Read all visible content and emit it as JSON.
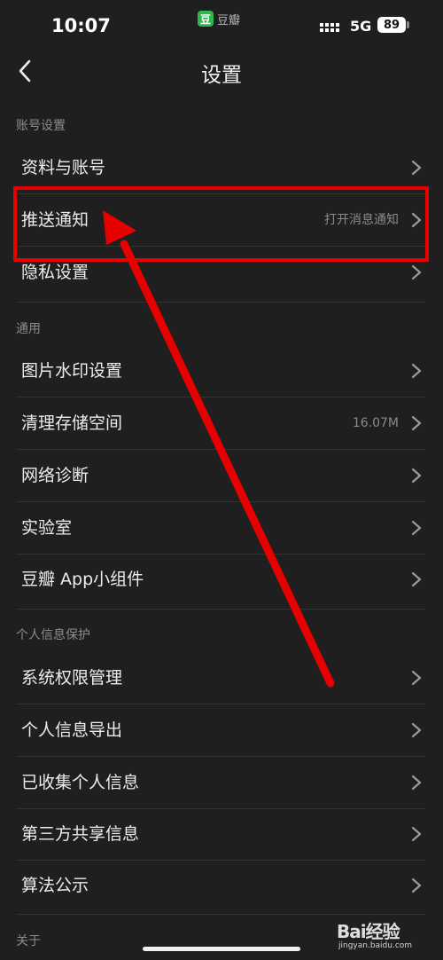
{
  "status_bar": {
    "time": "10:07",
    "app_name": "豆瓣",
    "app_icon_char": "豆",
    "network": "5G",
    "battery": "89"
  },
  "nav": {
    "title": "设置",
    "back_icon": "chevron-left-icon"
  },
  "sections": [
    {
      "header": "账号设置",
      "items": [
        {
          "label": "资料与账号",
          "value": ""
        },
        {
          "label": "推送通知",
          "value": "打开消息通知"
        },
        {
          "label": "隐私设置",
          "value": ""
        }
      ]
    },
    {
      "header": "通用",
      "items": [
        {
          "label": "图片水印设置",
          "value": ""
        },
        {
          "label": "清理存储空间",
          "value": "16.07M"
        },
        {
          "label": "网络诊断",
          "value": ""
        },
        {
          "label": "实验室",
          "value": ""
        },
        {
          "label": "豆瓣 App小组件",
          "value": ""
        }
      ]
    },
    {
      "header": "个人信息保护",
      "items": [
        {
          "label": "系统权限管理",
          "value": ""
        },
        {
          "label": "个人信息导出",
          "value": ""
        },
        {
          "label": "已收集个人信息",
          "value": ""
        },
        {
          "label": "第三方共享信息",
          "value": ""
        },
        {
          "label": "算法公示",
          "value": ""
        }
      ]
    },
    {
      "header": "关于",
      "items": []
    }
  ],
  "annotation": {
    "highlight_color": "#e60000",
    "arrow_color": "#e60000"
  },
  "watermark": {
    "text": "Bai经验",
    "sub": "jingyan.baidu.com"
  }
}
